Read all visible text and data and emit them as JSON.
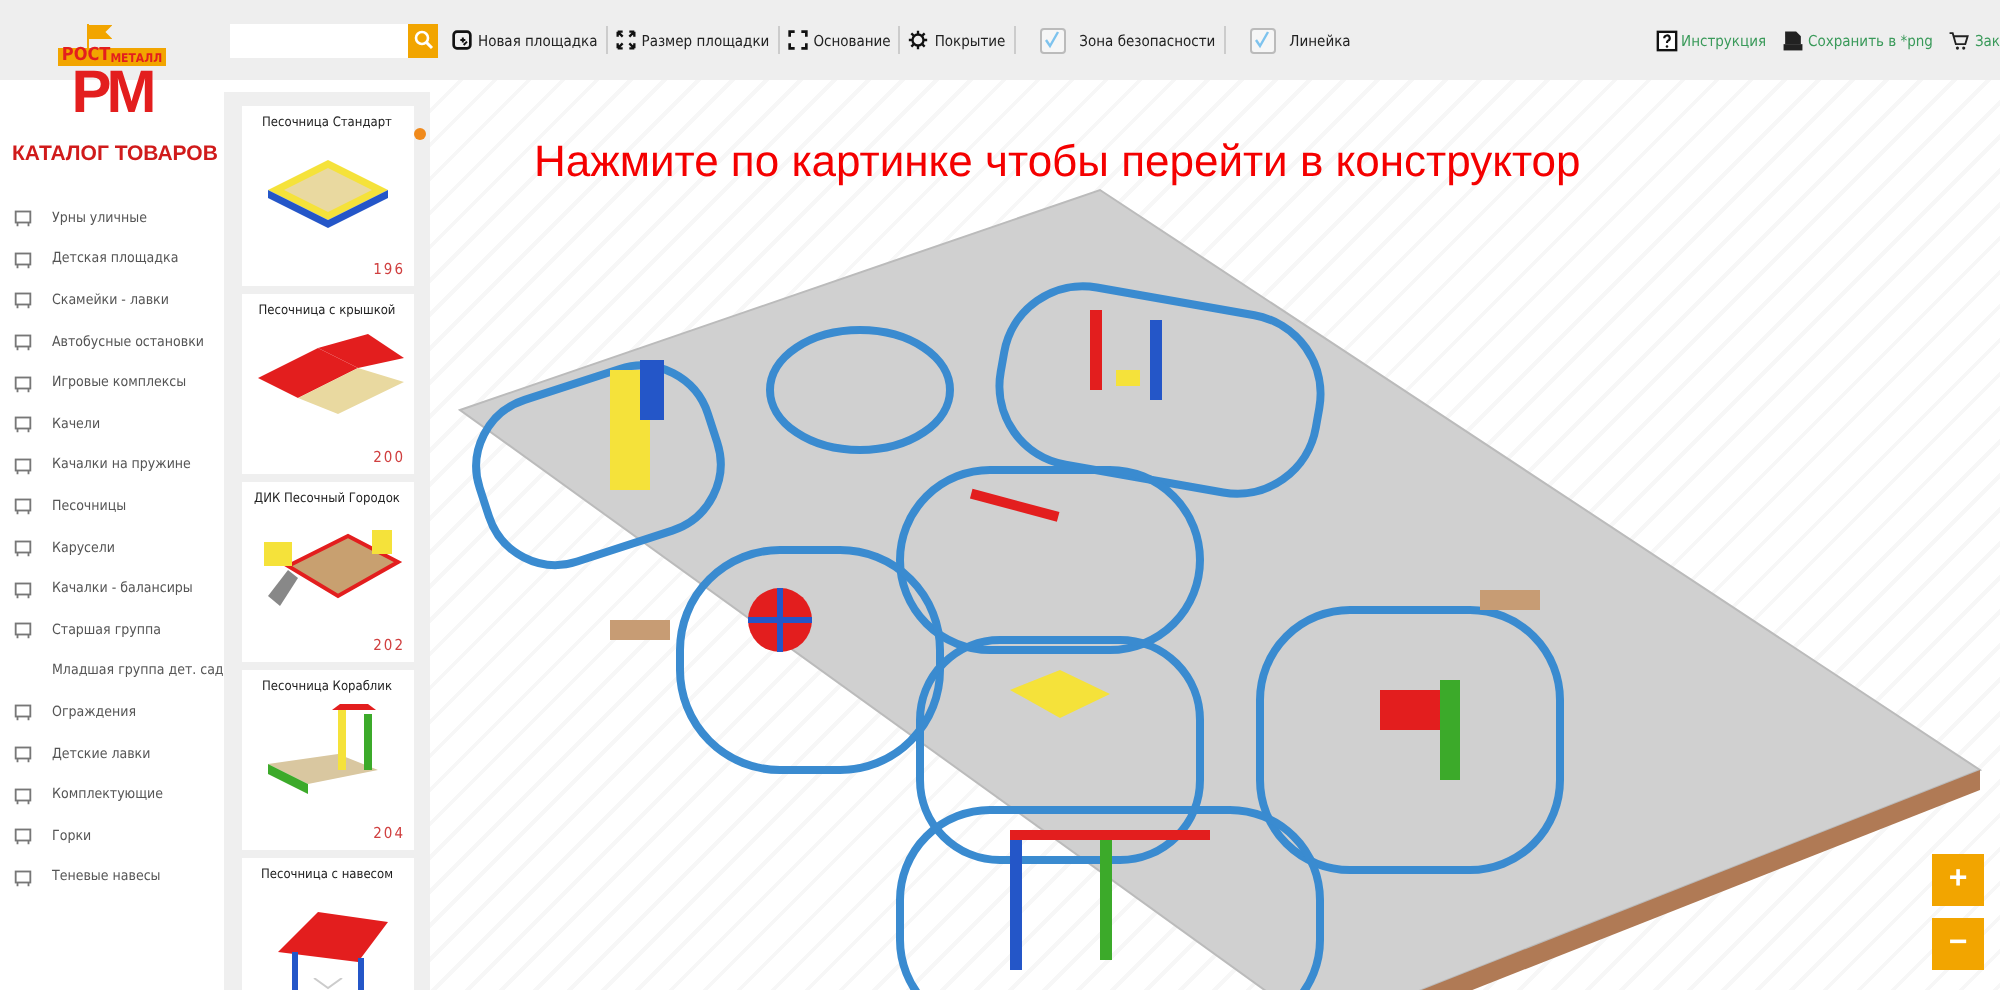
{
  "toolbar": {
    "tools": [
      {
        "kind": "action",
        "label": "Новая площадка"
      },
      {
        "kind": "action",
        "label": "Размер площадки"
      },
      {
        "kind": "action",
        "label": "Основание"
      },
      {
        "kind": "action",
        "label": "Покрытие"
      },
      {
        "kind": "checkbox",
        "label": "Зона безопасности",
        "checked": true
      },
      {
        "kind": "checkbox",
        "label": "Линейка",
        "checked": true
      }
    ],
    "links": [
      {
        "kind": "help",
        "label": "Инструкция"
      },
      {
        "kind": "png",
        "label": "Сохранить в *png"
      },
      {
        "kind": "cart",
        "label": "Зак"
      }
    ]
  },
  "logo": {
    "top": "РОСТ",
    "side": "МЕТАЛЛ",
    "letters": "РМ"
  },
  "catalog": {
    "title": "КАТАЛОГ ТОВАРОВ",
    "items": [
      {
        "label": "Урны уличные"
      },
      {
        "label": "Детская площадка"
      },
      {
        "label": "Скамейки - лавки"
      },
      {
        "label": "Автобусные остановки"
      },
      {
        "label": "Игровые комплексы"
      },
      {
        "label": "Качели"
      },
      {
        "label": "Качалки на пружине"
      },
      {
        "label": "Песочницы"
      },
      {
        "label": "Карусели"
      },
      {
        "label": "Качалки - балансиры"
      },
      {
        "label": "Старшая группа"
      },
      {
        "label": "Младшая группа дет. сад"
      },
      {
        "label": "Ограждения"
      },
      {
        "label": "Детские лавки"
      },
      {
        "label": "Комплектующие"
      },
      {
        "label": "Горки"
      },
      {
        "label": "Теневые навесы"
      }
    ]
  },
  "products": [
    {
      "name": "Песочница Стандарт",
      "price": "196",
      "kind": "sandbox"
    },
    {
      "name": "Песочница с крышкой",
      "price": "200",
      "kind": "lid"
    },
    {
      "name": "ДИК Песочный Городок",
      "price": "202",
      "kind": "town"
    },
    {
      "name": "Песочница Кораблик",
      "price": "204",
      "kind": "ship"
    },
    {
      "name": "Песочница с навесом",
      "kind": "canopy"
    }
  ],
  "canvas": {
    "hint": "Нажмите по картинке чтобы перейти в конструктор",
    "zoom_in": "+",
    "zoom_out": "−"
  }
}
